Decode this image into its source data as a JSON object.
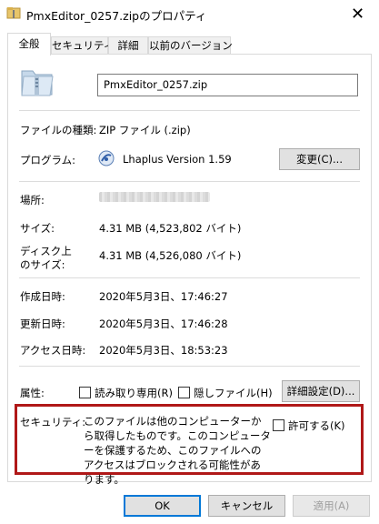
{
  "window": {
    "title": "PmxEditor_0257.zipのプロパティ",
    "close_glyph": "✕"
  },
  "tabs": [
    {
      "label": "全般"
    },
    {
      "label": "セキュリティ"
    },
    {
      "label": "詳細"
    },
    {
      "label": "以前のバージョン"
    }
  ],
  "general": {
    "file_name": "PmxEditor_0257.zip",
    "file_icon": "zip-folder-icon",
    "type_label": "ファイルの種類:",
    "type_value": "ZIP ファイル (.zip)",
    "program_label": "プログラム:",
    "program_icon": "lhaplus-app-icon",
    "program_value": "Lhaplus Version 1.59",
    "change_button": "変更(C)...",
    "location_label": "場所:",
    "size_label": "サイズ:",
    "size_value": "4.31 MB (4,523,802 バイト)",
    "disk_size_label_1": "ディスク上",
    "disk_size_label_2": "のサイズ:",
    "disk_size_value": "4.31 MB (4,526,080 バイト)",
    "created_label": "作成日時:",
    "created_value": "2020年5月3日、17:46:27",
    "modified_label": "更新日時:",
    "modified_value": "2020年5月3日、17:46:28",
    "accessed_label": "アクセス日時:",
    "accessed_value": "2020年5月3日、18:53:23",
    "attributes_label": "属性:",
    "readonly_label": "読み取り専用(R)",
    "readonly_checked": false,
    "hidden_label": "隠しファイル(H)",
    "hidden_checked": false,
    "advanced_button": "詳細設定(D)...",
    "security_label": "セキュリティ:",
    "security_text": "このファイルは他のコンピューターから取得したものです。このコンピューターを保護するため、このファイルへのアクセスはブロックされる可能性があります。",
    "unblock_label": "許可する(K)",
    "unblock_checked": false
  },
  "footer": {
    "ok": "OK",
    "cancel": "キャンセル",
    "apply": "適用(A)"
  },
  "colors": {
    "highlight_border": "#b01818",
    "default_button_border": "#0078d7"
  }
}
